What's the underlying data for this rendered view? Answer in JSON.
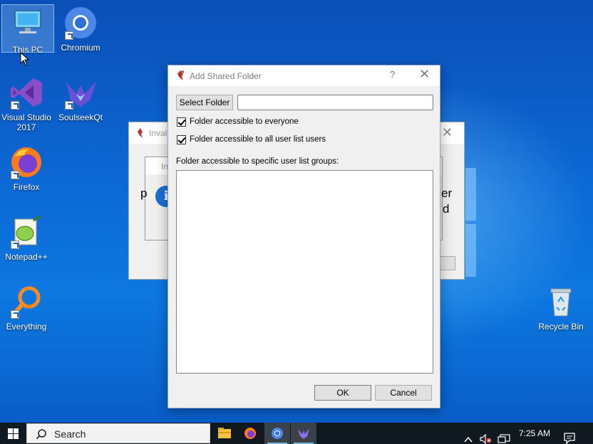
{
  "desktop": {
    "icons": [
      {
        "label": "This PC"
      },
      {
        "label": "Chromium"
      },
      {
        "label": "Visual Studio 2017"
      },
      {
        "label": "SoulseekQt"
      },
      {
        "label": "Firefox"
      },
      {
        "label": "Notepad++"
      },
      {
        "label": "Everything"
      },
      {
        "label": "Recycle Bin"
      }
    ]
  },
  "background_dialog": {
    "title": "Inval",
    "inner_title": "In",
    "left_text": "p",
    "right_text_1": "er",
    "right_text_2": "d"
  },
  "dialog": {
    "title": "Add Shared Folder",
    "help": "?",
    "close": "✕",
    "select_folder_label": "Select Folder",
    "folder_value": "",
    "folder_placeholder": "",
    "checkboxes": [
      {
        "label": "Folder accessible to everyone",
        "checked": true
      },
      {
        "label": "Folder accessible to all user list users",
        "checked": true
      }
    ],
    "groups_label": "Folder accessible to specific user list groups:",
    "ok_label": "OK",
    "cancel_label": "Cancel"
  },
  "taskbar": {
    "search_label": "Search",
    "clock": "7:25 AM",
    "apps": [
      {
        "name": "file-explorer-icon"
      },
      {
        "name": "firefox-icon"
      },
      {
        "name": "chromium-icon"
      },
      {
        "name": "soulseekqt-icon"
      }
    ]
  },
  "colors": {
    "wallpaper": "#0c6ad6",
    "taskbar": "#101820",
    "accent": "#76b9ed"
  }
}
